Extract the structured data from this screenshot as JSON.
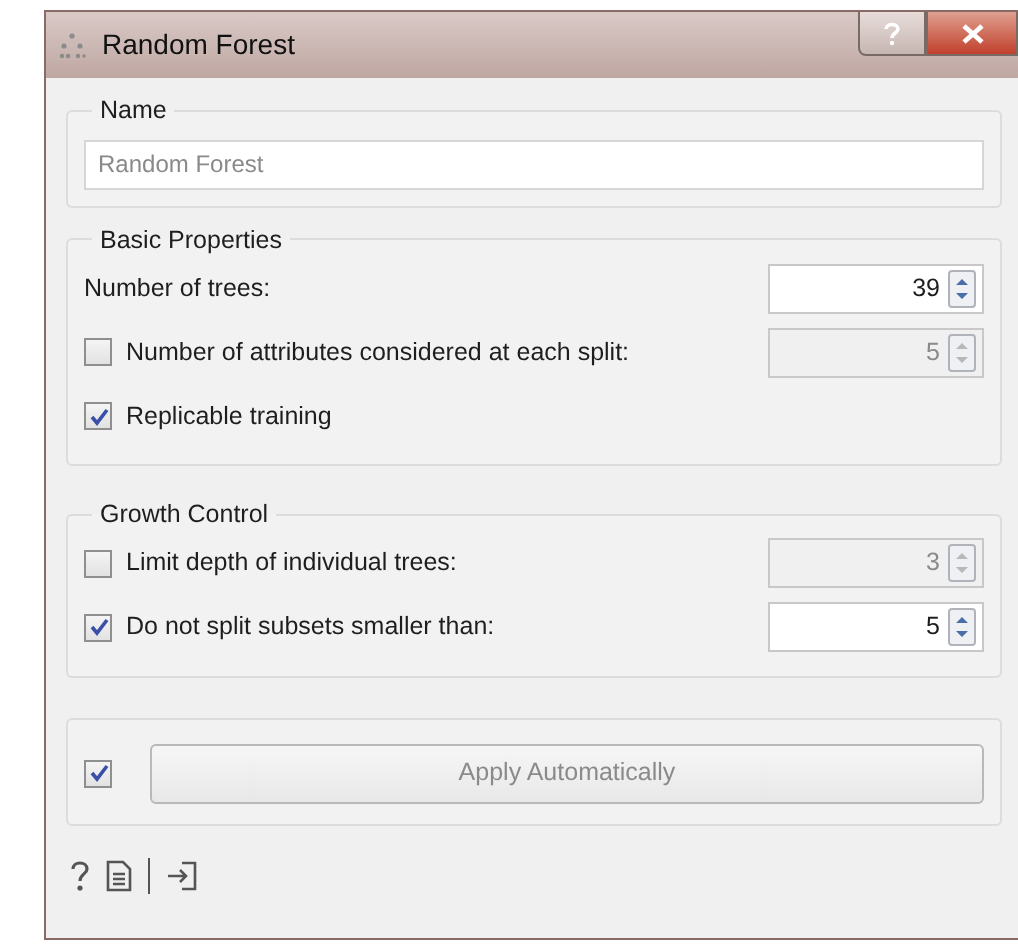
{
  "window": {
    "title": "Random Forest"
  },
  "name_group": {
    "title": "Name",
    "placeholder": "Random Forest"
  },
  "basic_properties": {
    "title": "Basic Properties",
    "rows": [
      {
        "kind": "spin",
        "label": "Number of trees:",
        "value": "39",
        "disabled": false
      },
      {
        "kind": "check-spin",
        "label": "Number of attributes considered at each split:",
        "checked": false,
        "value": "5",
        "disabled": true
      },
      {
        "kind": "check",
        "label": "Replicable training",
        "checked": true
      }
    ]
  },
  "growth_control": {
    "title": "Growth Control",
    "rows": [
      {
        "kind": "check-spin",
        "label": "Limit depth of individual trees:",
        "checked": false,
        "value": "3",
        "disabled": true
      },
      {
        "kind": "check-spin",
        "label": "Do not split subsets smaller than:",
        "checked": true,
        "value": "5",
        "disabled": false
      }
    ]
  },
  "apply": {
    "checked": true,
    "label": "Apply Automatically",
    "disabled": true
  }
}
